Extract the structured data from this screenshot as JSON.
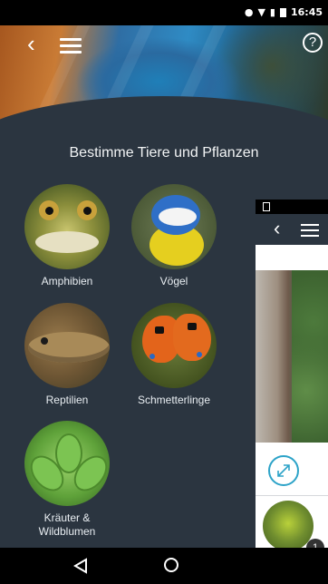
{
  "status_bar": {
    "time": "16:45"
  },
  "header": {
    "title": "Bestimme Tiere und Pflanzen"
  },
  "categories": [
    {
      "label": "Amphibien"
    },
    {
      "label": "Vögel"
    },
    {
      "label": "Reptilien"
    },
    {
      "label": "Schmetterlinge"
    },
    {
      "label": "Kräuter &"
    },
    {
      "label": "Wildblumen"
    }
  ],
  "icons": {
    "help": "?",
    "back": "‹"
  },
  "second_screen": {
    "badge_count": "1"
  },
  "colors": {
    "background": "#2b3540",
    "accent": "#2da3c8"
  }
}
